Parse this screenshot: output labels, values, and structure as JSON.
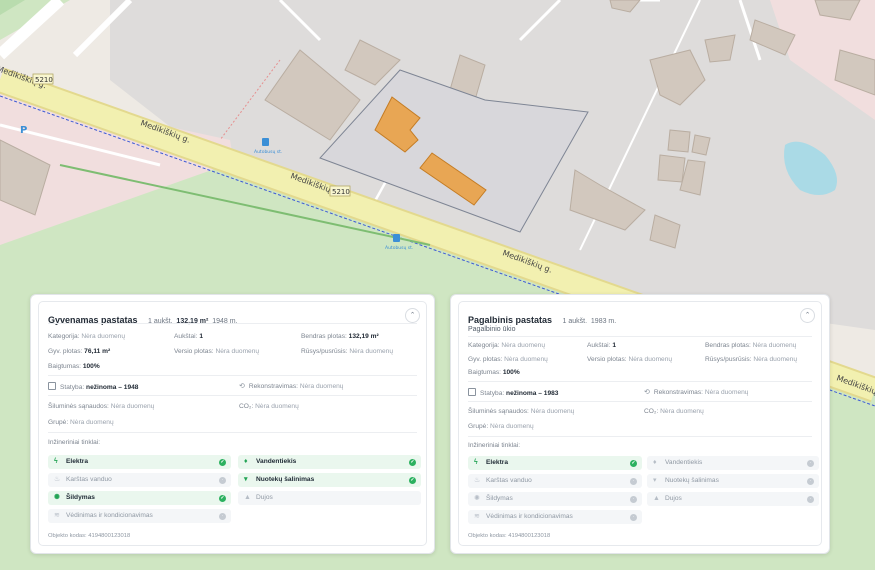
{
  "map": {
    "road_label": "Medikiškių g.",
    "road_number": "5210",
    "stop_label": "Autobusų st.",
    "parking_label": "P",
    "colors": {
      "road": "#f2f0b0",
      "water": "#aadae6",
      "parcel": "#e8a654",
      "forest": "#cfe6c2",
      "pink": "#f1dede"
    }
  },
  "card1": {
    "title": "Gyvenamas pastatas",
    "floors": "1 aukšt.",
    "area": "132,19 m²",
    "year": "1948 m.",
    "fields": {
      "kategorija_label": "Kategorija:",
      "kategorija_value": "Nėra duomenų",
      "aukstai_label": "Aukštai:",
      "aukstai_value": "1",
      "bendras_label": "Bendras plotas:",
      "bendras_value": "132,19 m²",
      "gyv_label": "Gyv. plotas:",
      "gyv_value": "76,11 m²",
      "versio_label": "Versio plotas:",
      "versio_value": "Nėra duomenų",
      "rusys_label": "Rūsys/pusrūsis:",
      "rusys_value": "Nėra duomenų",
      "baigtumas_label": "Baigtumas:",
      "baigtumas_value": "100%",
      "statyba_label": "Statyba:",
      "statyba_value": "nežinoma – 1948",
      "rekon_label": "Rekonstravimas:",
      "rekon_value": "Nėra duomenų",
      "siluma_label": "Šiluminės sąnaudos:",
      "siluma_value": "Nėra duomenų",
      "co2_label": "CO₂:",
      "co2_value": "Nėra duomenų",
      "grupe_label": "Grupė:",
      "grupe_value": "Nėra duomenų"
    },
    "utilities_label": "Inžineriniai tinklai:",
    "utilities": [
      {
        "label": "Elektra",
        "on": true,
        "icon": "lightning-icon"
      },
      {
        "label": "Vandentiekis",
        "on": true,
        "icon": "water-drop-icon"
      },
      {
        "label": "Karštas vanduo",
        "on": false,
        "icon": "hot-water-icon"
      },
      {
        "label": "Nuotekų šalinimas",
        "on": true,
        "icon": "sewer-icon"
      },
      {
        "label": "Šildymas",
        "on": true,
        "icon": "heating-icon"
      },
      {
        "label": "Dujos",
        "on": false,
        "icon": "gas-icon"
      },
      {
        "label": "Vėdinimas ir kondicionavimas",
        "on": false,
        "icon": "ventilation-icon"
      }
    ],
    "object_code": "Objekto kodas: 4194800123018"
  },
  "card2": {
    "title": "Pagalbinis pastatas",
    "floors": "1 aukšt.",
    "year": "1983 m.",
    "subtitle": "Pagalbinio ūkio",
    "fields": {
      "kategorija_label": "Kategorija:",
      "kategorija_value": "Nėra duomenų",
      "aukstai_label": "Aukštai:",
      "aukstai_value": "1",
      "bendras_label": "Bendras plotas:",
      "bendras_value": "Nėra duomenų",
      "gyv_label": "Gyv. plotas:",
      "gyv_value": "Nėra duomenų",
      "versio_label": "Versio plotas:",
      "versio_value": "Nėra duomenų",
      "rusys_label": "Rūsys/pusrūsis:",
      "rusys_value": "Nėra duomenų",
      "baigtumas_label": "Baigtumas:",
      "baigtumas_value": "100%",
      "statyba_label": "Statyba:",
      "statyba_value": "nežinoma – 1983",
      "rekon_label": "Rekonstravimas:",
      "rekon_value": "Nėra duomenų",
      "siluma_label": "Šiluminės sąnaudos:",
      "siluma_value": "Nėra duomenų",
      "co2_label": "CO₂:",
      "co2_value": "Nėra duomenų",
      "grupe_label": "Grupė:",
      "grupe_value": "Nėra duomenų"
    },
    "utilities_label": "Inžineriniai tinklai:",
    "utilities": [
      {
        "label": "Elektra",
        "on": true,
        "icon": "lightning-icon"
      },
      {
        "label": "Vandentiekis",
        "on": false,
        "icon": "water-drop-icon"
      },
      {
        "label": "Karštas vanduo",
        "on": false,
        "icon": "hot-water-icon"
      },
      {
        "label": "Nuotekų šalinimas",
        "on": false,
        "icon": "sewer-icon"
      },
      {
        "label": "Šildymas",
        "on": false,
        "icon": "heating-icon"
      },
      {
        "label": "Dujos",
        "on": false,
        "icon": "gas-icon"
      },
      {
        "label": "Vėdinimas ir kondicionavimas",
        "on": false,
        "icon": "ventilation-icon"
      }
    ],
    "object_code": "Objekto kodas: 4194800123018"
  }
}
